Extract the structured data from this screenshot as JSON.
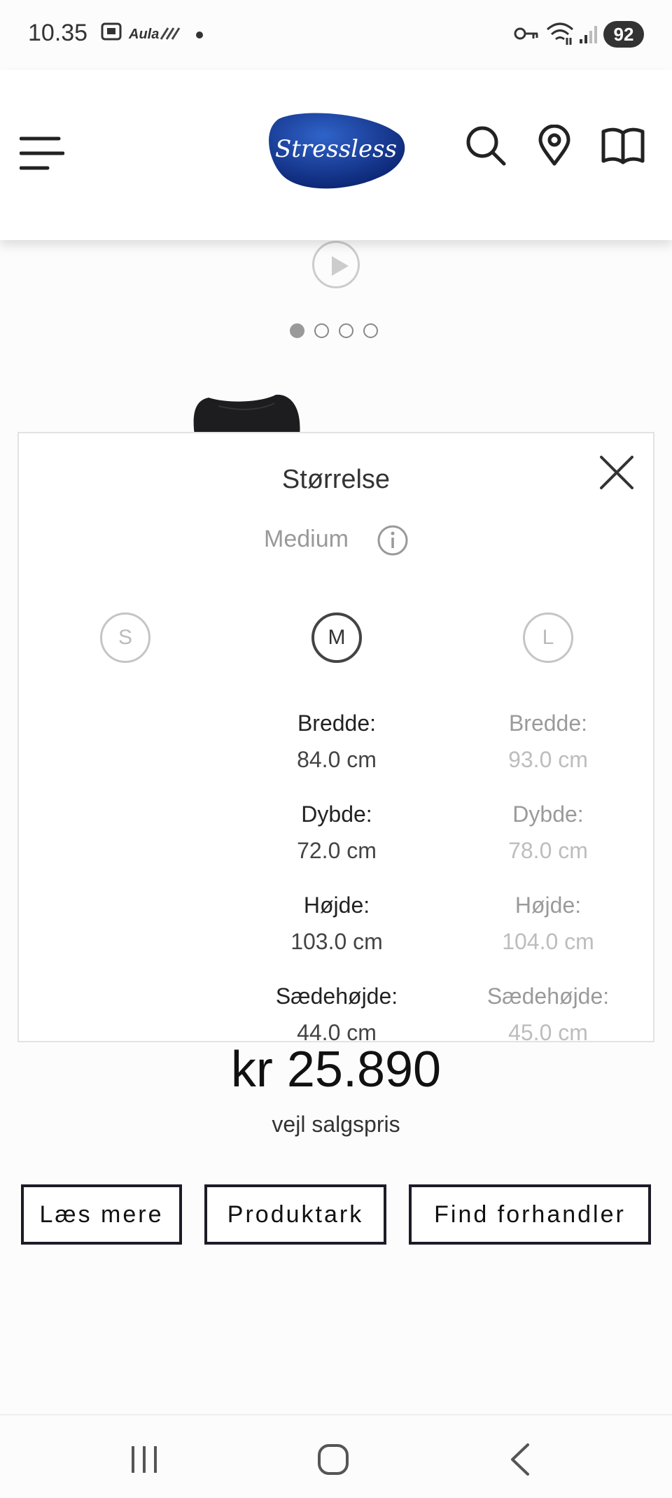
{
  "status_bar": {
    "time": "10.35",
    "app_label": "Aula",
    "battery": "92"
  },
  "header": {
    "logo_text": "Stressless",
    "brand_color": "#0c2a7a"
  },
  "gallery": {
    "slide_count": 4,
    "active_slide": 1
  },
  "size_popup": {
    "title": "Størrelse",
    "selected_size": "Medium",
    "sizes": [
      {
        "code": "S"
      },
      {
        "code": "M"
      },
      {
        "code": "L"
      }
    ],
    "columns": [
      {
        "size": "M",
        "rows": [
          {
            "label": "Bredde:",
            "value": "84.0 cm"
          },
          {
            "label": "Dybde:",
            "value": "72.0 cm"
          },
          {
            "label": "Højde:",
            "value": "103.0 cm"
          },
          {
            "label": "Sædehøjde:",
            "value": "44.0 cm"
          }
        ]
      },
      {
        "size": "L",
        "rows": [
          {
            "label": "Bredde:",
            "value": "93.0 cm"
          },
          {
            "label": "Dybde:",
            "value": "78.0 cm"
          },
          {
            "label": "Højde:",
            "value": "104.0 cm"
          },
          {
            "label": "Sædehøjde:",
            "value": "45.0 cm"
          }
        ]
      }
    ]
  },
  "price": {
    "amount": "kr 25.890",
    "note": "vejl salgspris"
  },
  "actions": {
    "read_more": "Læs mere",
    "product_sheet": "Produktark",
    "find_dealer": "Find forhandler"
  }
}
